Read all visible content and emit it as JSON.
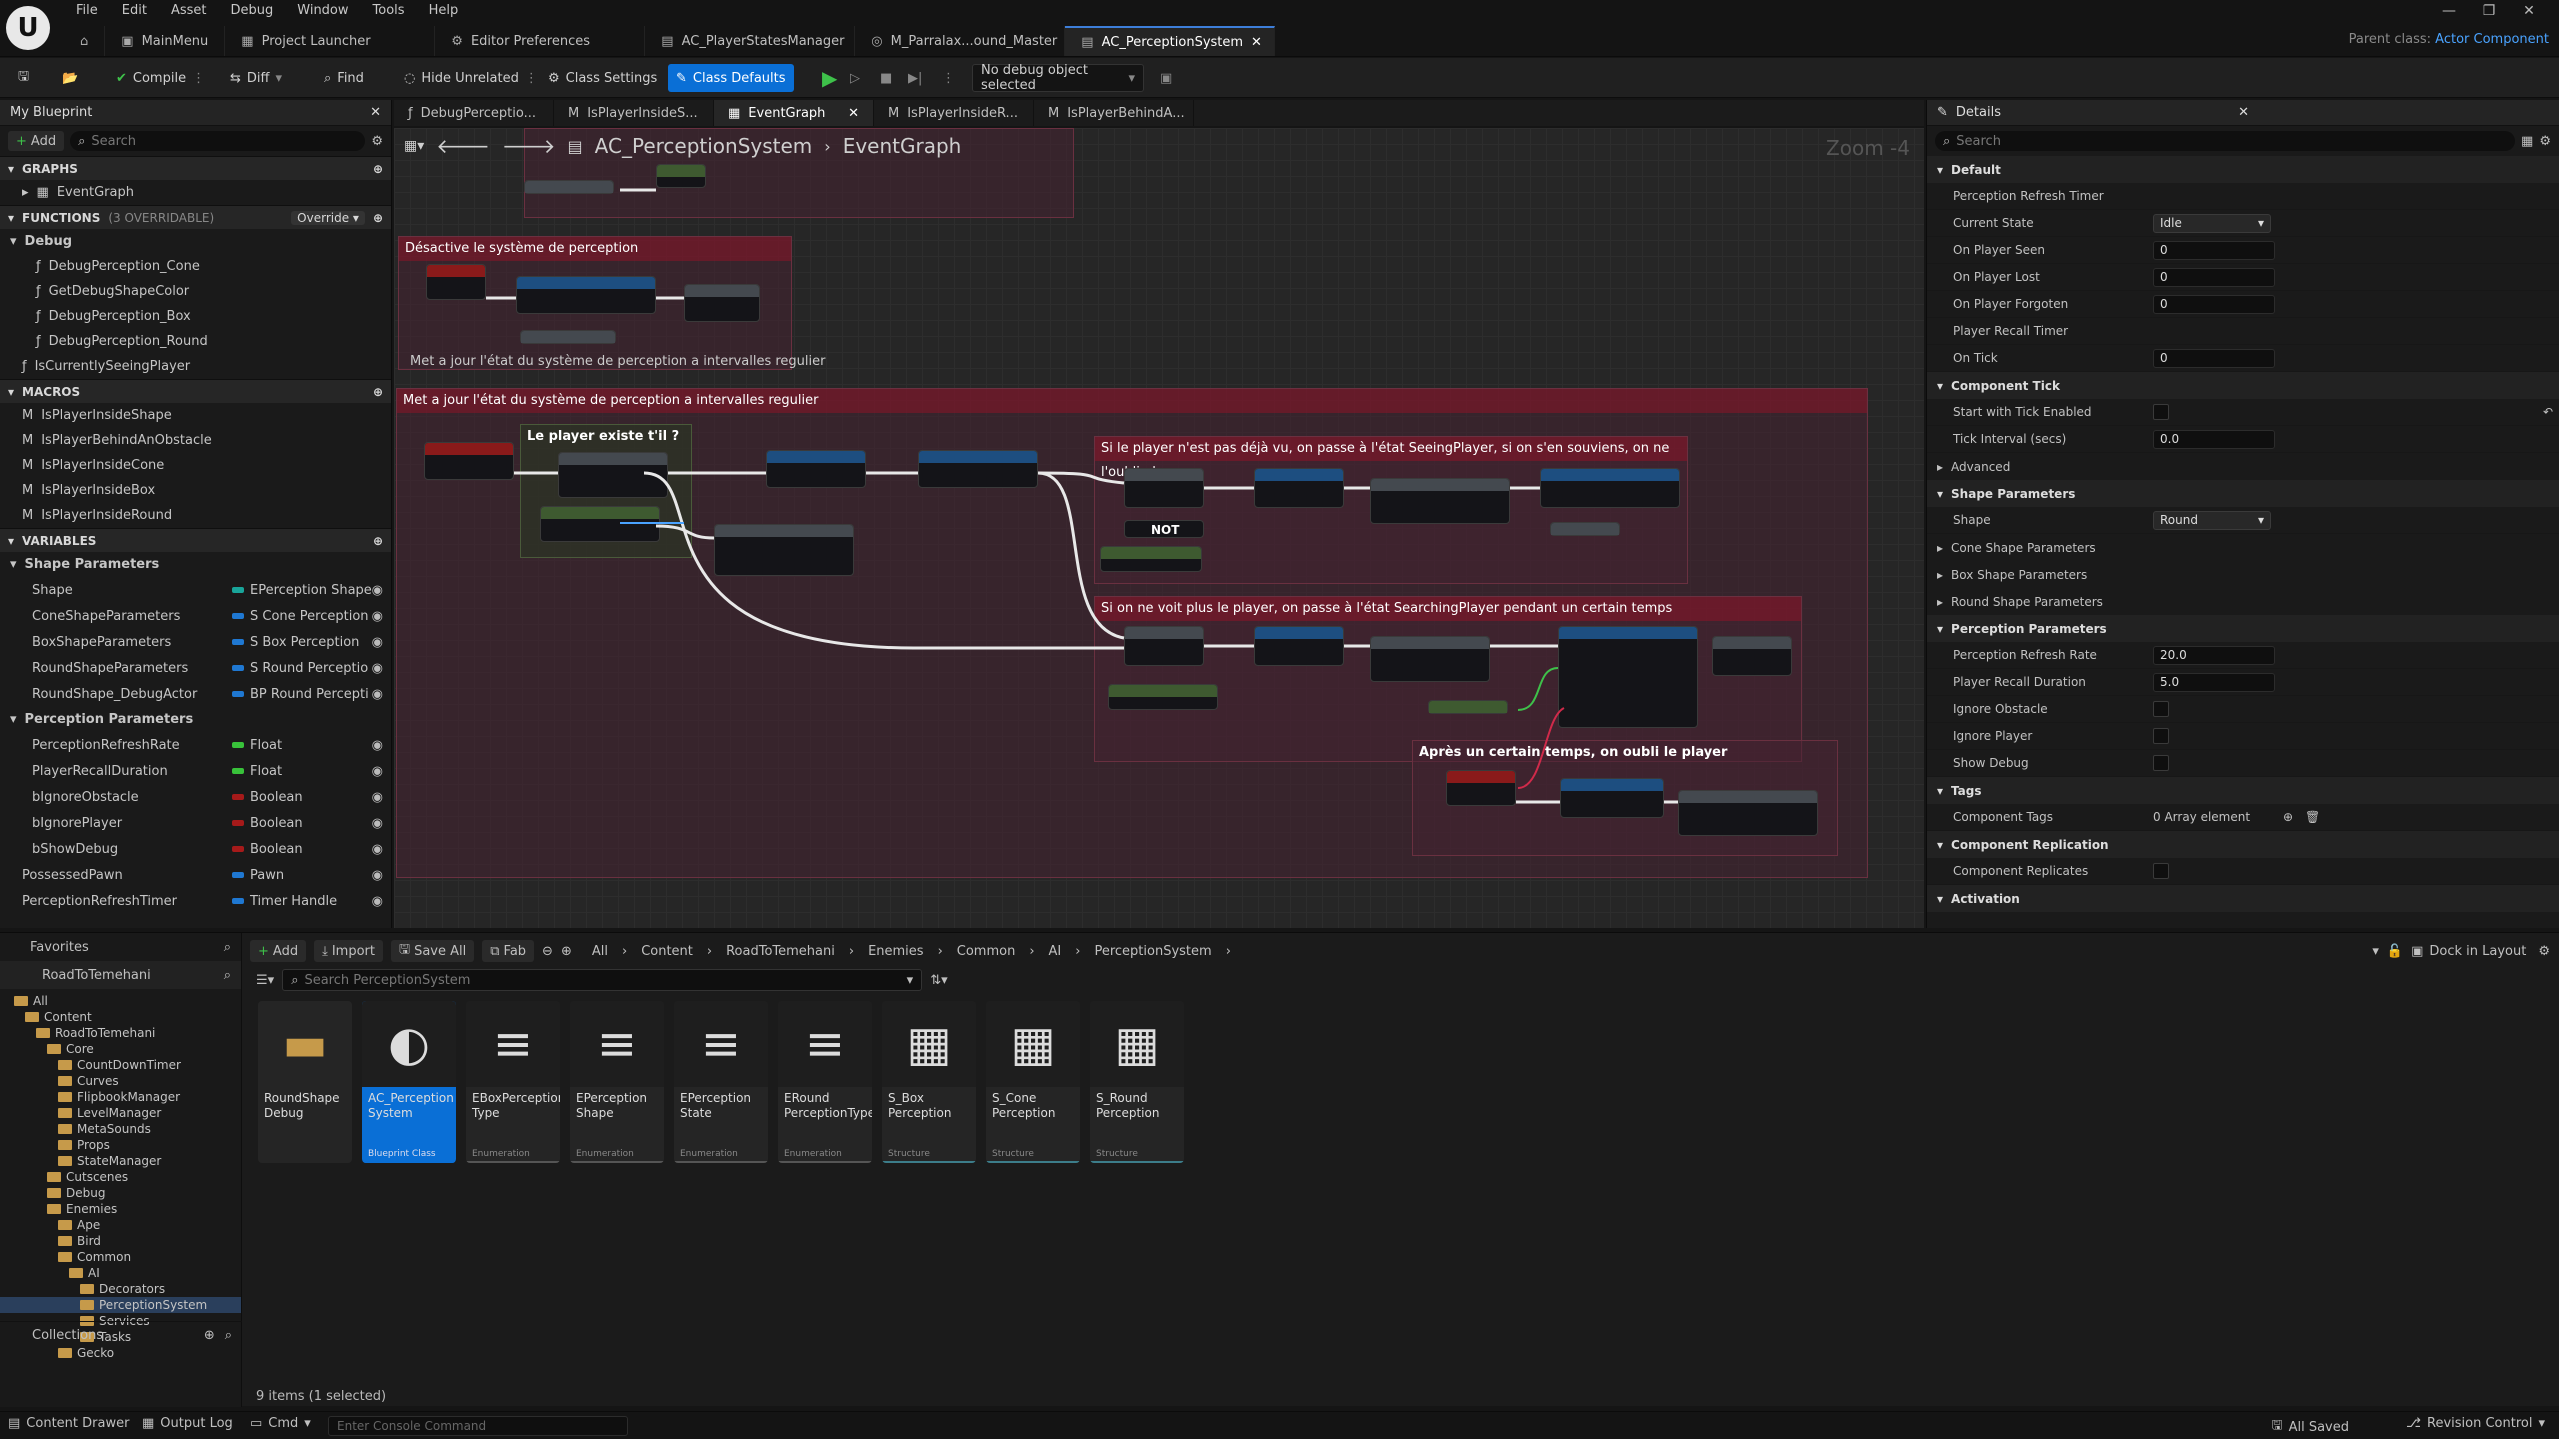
{
  "menu": [
    "File",
    "Edit",
    "Asset",
    "Debug",
    "Window",
    "Tools",
    "Help"
  ],
  "logo": "U",
  "window_controls": [
    "—",
    "❐",
    "✕"
  ],
  "doc_tabs": [
    {
      "icon": "⌂",
      "label": ""
    },
    {
      "icon": "▣",
      "label": "MainMenu"
    },
    {
      "icon": "▦",
      "label": "Project Launcher"
    },
    {
      "icon": "⚙",
      "label": "Editor Preferences"
    },
    {
      "icon": "▤",
      "label": "AC_PlayerStatesManager"
    },
    {
      "icon": "◎",
      "label": "M_Parralax...ound_Master"
    },
    {
      "icon": "▤",
      "label": "AC_PerceptionSystem",
      "active": true
    }
  ],
  "parent_class": {
    "label": "Parent class:",
    "value": "Actor Component"
  },
  "toolbar": {
    "compile": "Compile",
    "diff": "Diff",
    "find": "Find",
    "hide_unrelated": "Hide Unrelated",
    "class_settings": "Class Settings",
    "class_defaults": "Class Defaults",
    "debug_object": "No debug object selected"
  },
  "my_blueprint": {
    "tab": "My Blueprint",
    "add": "Add",
    "search_placeholder": "Search",
    "graphs_header": "GRAPHS",
    "event_graph": "EventGraph",
    "functions_header": "FUNCTIONS",
    "functions_count": "(3 OVERRIDABLE)",
    "override": "Override",
    "debug_category": "Debug",
    "functions": [
      "DebugPerception_Cone",
      "GetDebugShapeColor",
      "DebugPerception_Box",
      "DebugPerception_Round"
    ],
    "function_root": "IsCurrentlySeeingPlayer",
    "macros_header": "MACROS",
    "macros": [
      "IsPlayerInsideShape",
      "IsPlayerBehindAnObstacle",
      "IsPlayerInsideCone",
      "IsPlayerInsideBox",
      "IsPlayerInsideRound"
    ],
    "variables_header": "VARIABLES",
    "shape_params_cat": "Shape Parameters",
    "shape_vars": [
      {
        "name": "Shape",
        "type": "EPerception Shape",
        "color": "#19a59a"
      },
      {
        "name": "ConeShapeParameters",
        "type": "S Cone Perception",
        "color": "#1f78d2"
      },
      {
        "name": "BoxShapeParameters",
        "type": "S Box Perception",
        "color": "#1f78d2"
      },
      {
        "name": "RoundShapeParameters",
        "type": "S Round Perceptio",
        "color": "#1f78d2"
      },
      {
        "name": "RoundShape_DebugActor",
        "type": "BP Round Percepti",
        "color": "#1f78d2"
      }
    ],
    "perception_params_cat": "Perception Parameters",
    "perception_vars": [
      {
        "name": "PerceptionRefreshRate",
        "type": "Float",
        "color": "#38c23a"
      },
      {
        "name": "PlayerRecallDuration",
        "type": "Float",
        "color": "#38c23a"
      },
      {
        "name": "bIgnoreObstacle",
        "type": "Boolean",
        "color": "#a61a1a"
      },
      {
        "name": "bIgnorePlayer",
        "type": "Boolean",
        "color": "#a61a1a"
      },
      {
        "name": "bShowDebug",
        "type": "Boolean",
        "color": "#a61a1a"
      }
    ],
    "root_vars": [
      {
        "name": "PossessedPawn",
        "type": "Pawn",
        "color": "#1f78d2"
      },
      {
        "name": "PerceptionRefreshTimer",
        "type": "Timer Handle",
        "color": "#1f78d2"
      }
    ]
  },
  "graph_tabs": [
    "DebugPerceptio...",
    "IsPlayerInsideS...",
    "EventGraph",
    "IsPlayerInsideR...",
    "IsPlayerBehindA..."
  ],
  "graph": {
    "breadcrumb_class": "AC_PerceptionSystem",
    "breadcrumb_graph": "EventGraph",
    "zoom": "Zoom -4",
    "comments": [
      "Désactive le système de perception",
      "Met a jour l'état du système de perception a intervalles regulier",
      "Met a jour l'état du système de perception a intervalles regulier",
      "Le player existe t'il ?",
      "Si le player n'est pas déjà vu, on passe à l'état SeeingPlayer, si on s'en souviens, on ne l'oubli plus",
      "Si on ne voit plus le player, on passe à l'état SearchingPlayer pendant un certain temps",
      "Après un certain temps, on oubli le player"
    ],
    "not_label": "NOT"
  },
  "details": {
    "tab": "Details",
    "search_placeholder": "Search",
    "default_header": "Default",
    "rows": [
      {
        "label": "Perception Refresh Timer",
        "value": ""
      },
      {
        "label": "Current State",
        "value": "Idle",
        "kind": "combo"
      },
      {
        "label": "On Player Seen",
        "value": "0",
        "kind": "field"
      },
      {
        "label": "On Player Lost",
        "value": "0",
        "kind": "field"
      },
      {
        "label": "On Player Forgoten",
        "value": "0",
        "kind": "field"
      },
      {
        "label": "Player Recall Timer",
        "value": ""
      },
      {
        "label": "On Tick",
        "value": "0",
        "kind": "field"
      }
    ],
    "component_tick": "Component Tick",
    "start_with_tick": "Start with Tick Enabled",
    "tick_interval": "Tick Interval (secs)",
    "tick_interval_value": "0.0",
    "advanced": "Advanced",
    "shape_params": "Shape Parameters",
    "shape_label": "Shape",
    "shape_value": "Round",
    "cone_params": "Cone Shape Parameters",
    "box_params": "Box Shape Parameters",
    "round_params": "Round Shape Parameters",
    "perception_params": "Perception Parameters",
    "refresh_rate": "Perception Refresh Rate",
    "refresh_rate_value": "20.0",
    "recall_duration": "Player Recall Duration",
    "recall_duration_value": "5.0",
    "ignore_obstacle": "Ignore Obstacle",
    "ignore_player": "Ignore Player",
    "show_debug": "Show Debug",
    "tags": "Tags",
    "component_tags": "Component Tags",
    "component_tags_value": "0 Array element",
    "replication": "Component Replication",
    "replicates": "Component Replicates",
    "activation": "Activation"
  },
  "content_browser": {
    "favorites": "Favorites",
    "project": "RoadToTemehani",
    "collections": "Collections",
    "tree": [
      {
        "name": "All",
        "depth": 0
      },
      {
        "name": "Content",
        "depth": 1
      },
      {
        "name": "RoadToTemehani",
        "depth": 2
      },
      {
        "name": "Core",
        "depth": 3
      },
      {
        "name": "CountDownTimer",
        "depth": 4
      },
      {
        "name": "Curves",
        "depth": 4
      },
      {
        "name": "FlipbookManager",
        "depth": 4
      },
      {
        "name": "LevelManager",
        "depth": 4
      },
      {
        "name": "MetaSounds",
        "depth": 4
      },
      {
        "name": "Props",
        "depth": 4
      },
      {
        "name": "StateManager",
        "depth": 4
      },
      {
        "name": "Cutscenes",
        "depth": 3
      },
      {
        "name": "Debug",
        "depth": 3
      },
      {
        "name": "Enemies",
        "depth": 3
      },
      {
        "name": "Ape",
        "depth": 4
      },
      {
        "name": "Bird",
        "depth": 4
      },
      {
        "name": "Common",
        "depth": 4
      },
      {
        "name": "AI",
        "depth": 5
      },
      {
        "name": "Decorators",
        "depth": 6
      },
      {
        "name": "PerceptionSystem",
        "depth": 6,
        "selected": true
      },
      {
        "name": "Services",
        "depth": 6
      },
      {
        "name": "Tasks",
        "depth": 6
      },
      {
        "name": "Gecko",
        "depth": 4
      }
    ],
    "add": "Add",
    "import": "Import",
    "save_all": "Save All",
    "fab": "Fab",
    "path": [
      "All",
      "Content",
      "RoadToTemehani",
      "Enemies",
      "Common",
      "AI",
      "PerceptionSystem"
    ],
    "search_placeholder": "Search PerceptionSystem",
    "dock": "Dock in Layout",
    "assets": [
      {
        "name": "RoundShape Debug",
        "type": "",
        "kind": "folder"
      },
      {
        "name": "AC_Perception System",
        "type": "Blueprint Class",
        "kind": "bp",
        "selected": true
      },
      {
        "name": "EBoxPerception Type",
        "type": "Enumeration",
        "kind": "enum"
      },
      {
        "name": "EPerception Shape",
        "type": "Enumeration",
        "kind": "enum"
      },
      {
        "name": "EPerception State",
        "type": "Enumeration",
        "kind": "enum"
      },
      {
        "name": "ERound PerceptionType",
        "type": "Enumeration",
        "kind": "enum"
      },
      {
        "name": "S_Box Perception",
        "type": "Structure",
        "kind": "struct"
      },
      {
        "name": "S_Cone Perception",
        "type": "Structure",
        "kind": "struct"
      },
      {
        "name": "S_Round Perception",
        "type": "Structure",
        "kind": "struct"
      }
    ],
    "count": "9 items (1 selected)"
  },
  "statusbar": {
    "content_drawer": "Content Drawer",
    "output_log": "Output Log",
    "cmd": "Cmd",
    "console_placeholder": "Enter Console Command",
    "all_saved": "All Saved",
    "revision": "Revision Control"
  }
}
